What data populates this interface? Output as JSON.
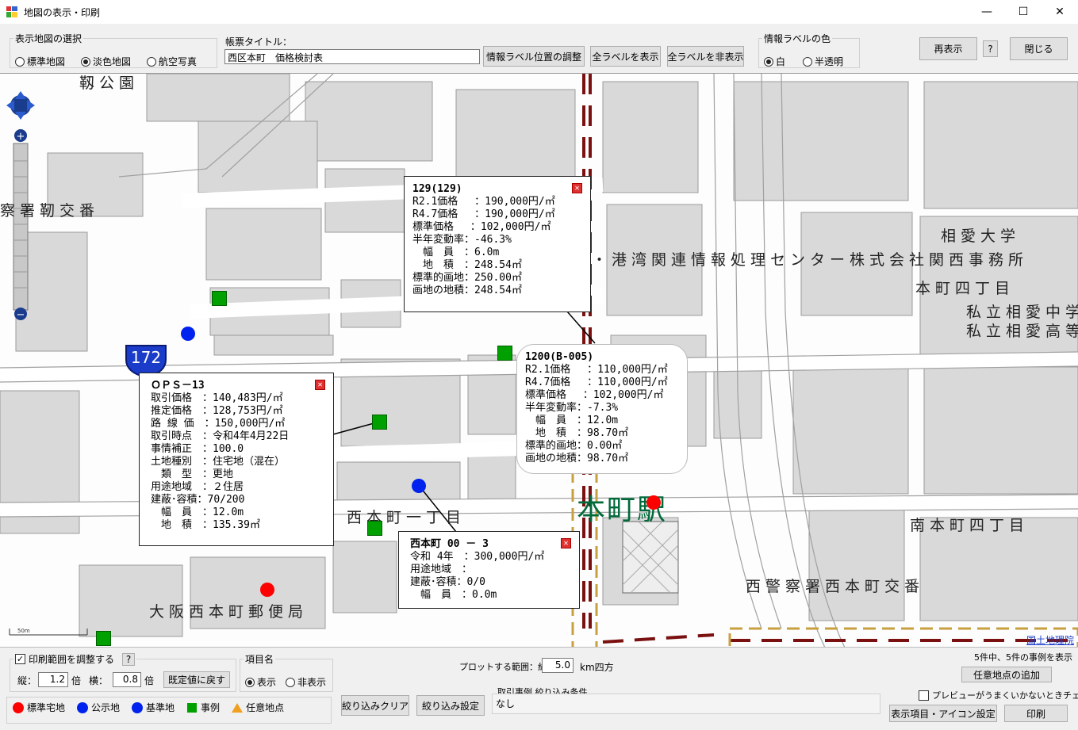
{
  "window": {
    "title": "地図の表示・印刷",
    "minimize": "—",
    "maximize": "☐",
    "close": "✕"
  },
  "toolbar": {
    "map_select_legend": "表示地図の選択",
    "map_options": [
      "標準地図",
      "淡色地図",
      "航空写真"
    ],
    "map_selected": "淡色地図",
    "report_title_label": "帳票タイトル：",
    "report_title_value": "西区本町　価格検討表",
    "adjust_label_btn": "情報ラベル位置の調整",
    "show_all_btn": "全ラベルを表示",
    "hide_all_btn": "全ラベルを非表示",
    "label_color_legend": "情報ラベルの色",
    "label_color_options": [
      "白",
      "半透明"
    ],
    "label_color_selected": "白",
    "redisplay_btn": "再表示",
    "help_btn": "?",
    "close_btn": "閉じる"
  },
  "map": {
    "route_number": "172",
    "scale_text": "50m",
    "gsi_link": "国土地理院",
    "labels": {
      "top_park": "靱公園",
      "police_box": "察署靭交番",
      "port_center": "・港湾関連情報処理センター株式会社関西事務所",
      "soai_univ": "相愛大学",
      "honmachi4": "本町四丁目",
      "soai_jhs": "私立相愛中学",
      "soai_hs": "私立相愛高等",
      "nishihonmachi1": "西本町一丁目",
      "station": "本町駅",
      "minamihonmachi4": "南本町四丁目",
      "police_west": "西警察署西本町交番",
      "post_office": "大阪西本町郵便局"
    },
    "info_boxes": [
      {
        "title": "129(129)",
        "rows": [
          "R2.1価格　 ：190,000円/㎡",
          "R4.7価格　 ：190,000円/㎡",
          "標準価格　 ：102,000円/㎡",
          "半年変動率：-46.3%",
          "　幅　員　：6.0m",
          "　地　積　：248.54㎡",
          "標準的画地：250.00㎡",
          "画地の地積：248.54㎡"
        ]
      },
      {
        "title": "1200(B-005)",
        "rows": [
          "R2.1価格　 ：110,000円/㎡",
          "R4.7価格　 ：110,000円/㎡",
          "標準価格　 ：102,000円/㎡",
          "半年変動率：-7.3%",
          "　幅　員　：12.0m",
          "　地　積　：98.70㎡",
          "標準的画地：0.00㎡",
          "画地の地積：98.70㎡"
        ]
      },
      {
        "title": "ＯＰＳ－13",
        "rows": [
          "取引価格　：140,483円/㎡",
          "推定価格　：128,753円/㎡",
          "路 線 価　：150,000円/㎡",
          "取引時点　：令和4年4月22日",
          "事情補正　：100.0",
          "土地種別　：住宅地（混在）",
          "　類　型　：更地",
          "用途地域　：２住居",
          "建蔽･容積：70/200",
          "　幅　員　：12.0m",
          "　地　積　：135.39㎡"
        ]
      },
      {
        "title": "西本町 00 － 3",
        "rows": [
          "令和 4年　：300,000円/㎡",
          "用途地域　：",
          "建蔽･容積：0/0",
          "　幅　員　：0.0m"
        ]
      }
    ]
  },
  "bottom": {
    "print_range_label": "印刷範囲を調整する",
    "help_btn": "?",
    "vertical_label": "縦：",
    "vertical_value": "1.2",
    "horizontal_label": "横：",
    "horizontal_value": "0.8",
    "times_unit": "倍",
    "reset_btn": "既定値に戻す",
    "item_name_legend": "項目名",
    "item_options": [
      "表示",
      "非表示"
    ],
    "item_selected": "表示",
    "plot_range_label": "プロットする範囲：約",
    "plot_range_value": "5.0",
    "plot_range_unit": "km四方",
    "case_count": "5件中、5件の事例を表示",
    "add_point_btn": "任意地点の追加",
    "preview_check_label": "プレビューがうまくいかないときチェック",
    "legend_items": [
      "標準宅地",
      "公示地",
      "基準地",
      "事例",
      "任意地点"
    ],
    "clear_filter_btn": "絞り込みクリア",
    "filter_setting_btn": "絞り込み設定",
    "filter_condition_label": "取引事例 絞り込み条件",
    "filter_condition_value": "なし",
    "display_setting_btn": "表示項目・アイコン設定",
    "print_btn": "印刷"
  },
  "colors": {
    "standard": "#ff0000",
    "public": "#0022ee",
    "case": "#00a000",
    "arbitrary": "#f0a020",
    "station_green": "#006a3a"
  }
}
